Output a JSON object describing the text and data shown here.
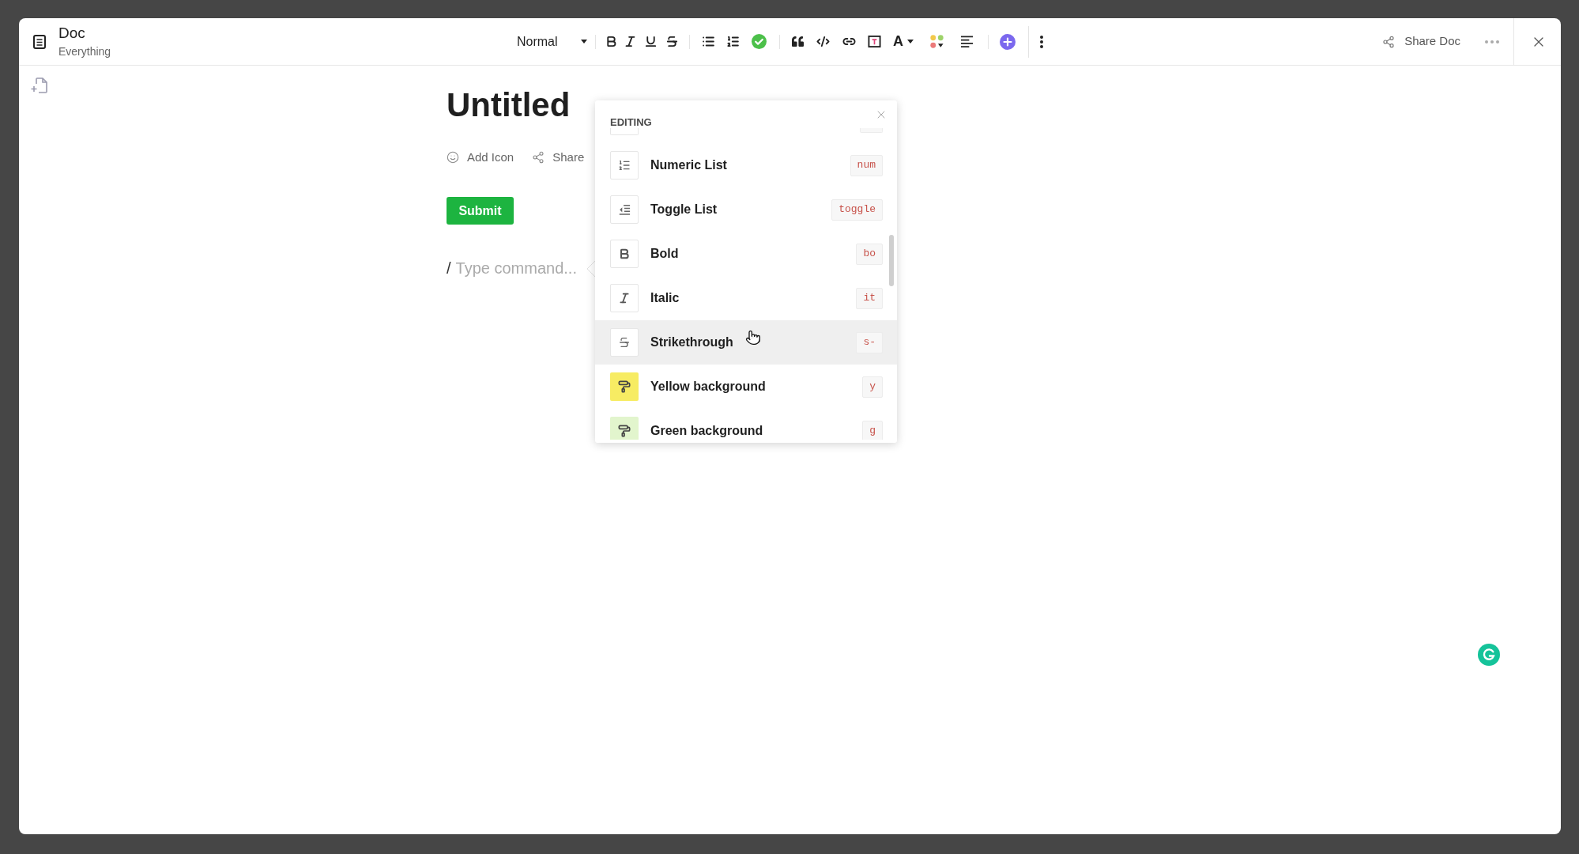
{
  "window": {
    "title": "Doc",
    "subtitle": "Everything"
  },
  "toolbar": {
    "style": "Normal",
    "font_color": "A"
  },
  "header_actions": {
    "share": "Share Doc"
  },
  "document": {
    "title": "Untitled",
    "actions": [
      {
        "kind": "add-icon",
        "label": "Add Icon"
      },
      {
        "kind": "share",
        "label": "Share"
      }
    ],
    "submit": "Submit",
    "command_input": {
      "value": "/",
      "placeholder": "Type command..."
    }
  },
  "command_menu": {
    "section": "EDITING",
    "items": [
      {
        "kind": "numbered-list",
        "label": "Numeric List",
        "shortcut": "num",
        "selected": false
      },
      {
        "kind": "toggle-list",
        "label": "Toggle List",
        "shortcut": "toggle",
        "selected": false
      },
      {
        "kind": "bold",
        "label": "Bold",
        "shortcut": "bo",
        "selected": false
      },
      {
        "kind": "italic",
        "label": "Italic",
        "shortcut": "it",
        "selected": false
      },
      {
        "kind": "strikethrough",
        "label": "Strikethrough",
        "shortcut": "s-",
        "selected": true
      },
      {
        "kind": "highlight",
        "label": "Yellow background",
        "shortcut": "y",
        "color": "#f7ec63",
        "selected": false
      },
      {
        "kind": "highlight",
        "label": "Green background",
        "shortcut": "g",
        "color": "#e2f5cd",
        "selected": false
      }
    ]
  }
}
